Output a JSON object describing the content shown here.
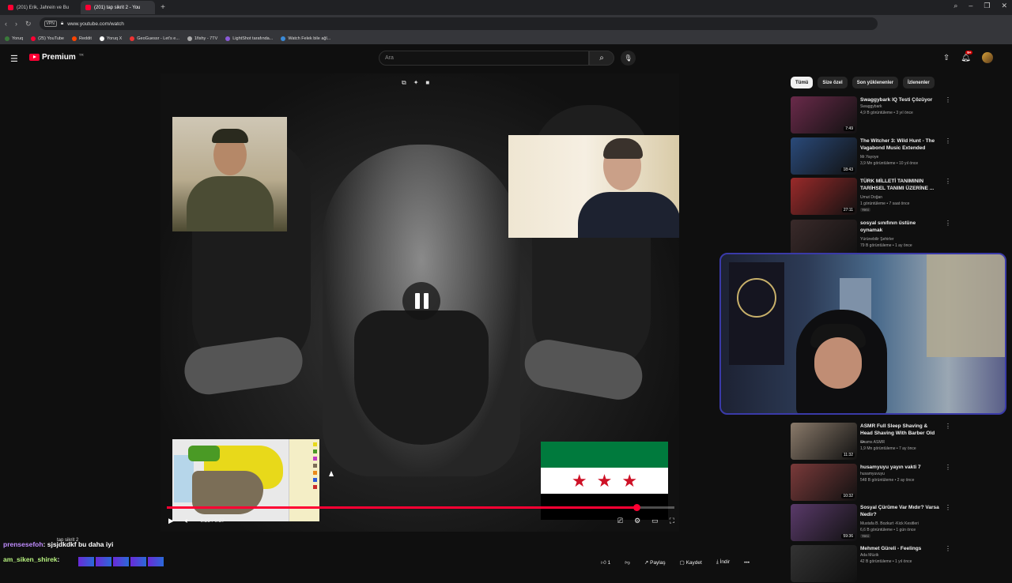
{
  "browser": {
    "tabs": [
      {
        "label": "(201) Erik, Jahrein ve Bu",
        "active": false
      },
      {
        "label": "(201) tap sikrit 2 - You",
        "active": true
      }
    ],
    "url": "www.youtube.com/watch",
    "vpn_label": "VPN",
    "bookmarks": [
      "Yoruq",
      "(25) YouTube",
      "Reddit",
      "Yoruq X",
      "GeoGuessr - Let's e...",
      "1fishy - 7TV",
      "LightShot tarafında...",
      "Watch Felek bile ağl..."
    ]
  },
  "youtube": {
    "logo_text": "Premium",
    "logo_sup": "TR",
    "search_placeholder": "Ara",
    "notif_badge": "9+"
  },
  "player": {
    "time": "0:25 / 0:27",
    "progress": 0.926
  },
  "chips": [
    {
      "label": "Tümü",
      "active": true
    },
    {
      "label": "Size özel",
      "active": false
    },
    {
      "label": "Son yüklenenler",
      "active": false
    },
    {
      "label": "İzlenenler",
      "active": false
    }
  ],
  "recommendations": [
    {
      "title": "Swaggybark IQ Testi Çözüyor",
      "channel": "Swaggybark",
      "meta": "4,9 B görüntüleme • 3 yıl önce",
      "duration": "7:49",
      "new": "",
      "thumb": "#6a2a4a"
    },
    {
      "title": "The Witcher 3: Wild Hunt - The Vagabond Music Extended",
      "channel": "Mr.Yayoye",
      "meta": "3,9 Mn görüntüleme • 10 yıl önce",
      "duration": "18:43",
      "new": "",
      "thumb": "#2a4a7a"
    },
    {
      "title": "TÜRK MİLLETİ TANIMININ TARİHSEL TANIMI ÜZERİNE ...",
      "channel": "Umut Doğan",
      "meta": "1 görüntüleme • 7 saat önce",
      "duration": "27:11",
      "new": "Yeni",
      "thumb": "#9a2a2a"
    },
    {
      "title": "sosyal sınıfının üstüne oynamak",
      "channel": "Yürünebilir Şehirler",
      "meta": "79 B görüntüleme • 1 ay önce",
      "duration": "",
      "new": "",
      "thumb": "#3a2a2a"
    },
    {
      "title": "ASMR Full Sleep Shaving & Head Shaving With Barber Old ...",
      "channel": "Shams ASMR",
      "meta": "1,9 Mn görüntüleme • 7 ay önce",
      "duration": "11:32",
      "new": "",
      "thumb": "#8a7a6a"
    },
    {
      "title": "husamyuyu yayın vakti 7",
      "channel": "husamyuvuyu",
      "meta": "548 B görüntüleme • 2 ay önce",
      "duration": "10:32",
      "new": "",
      "thumb": "#7a3a3a"
    },
    {
      "title": "Sosyal Çürüme Var Mıdır? Varsa Nedir?",
      "channel": "Mustafa B. Bozkurt -Kick Kesitleri",
      "meta": "6,6 B görüntüleme • 1 gün önce",
      "duration": "59:36",
      "new": "Yeni",
      "thumb": "#5a3a6a"
    },
    {
      "title": "Mehmet Güreli - Feelings",
      "channel": "Ada Müzik",
      "meta": "42 B görüntüleme • 1 yıl önce",
      "duration": "",
      "new": "",
      "thumb": "#333"
    }
  ],
  "chat": {
    "title": "tap sikrit 2",
    "sub": "Ol Carla Bell",
    "line1_name": "prensesefoh",
    "line1_msg": ": sjsjdkdkf bu daha iyi",
    "line2_name": "am_siken_shirek",
    "line2_msg": ":"
  },
  "actions": {
    "likes": "1",
    "share": "Paylaş",
    "save": "Kaydet",
    "download": "İndir"
  }
}
